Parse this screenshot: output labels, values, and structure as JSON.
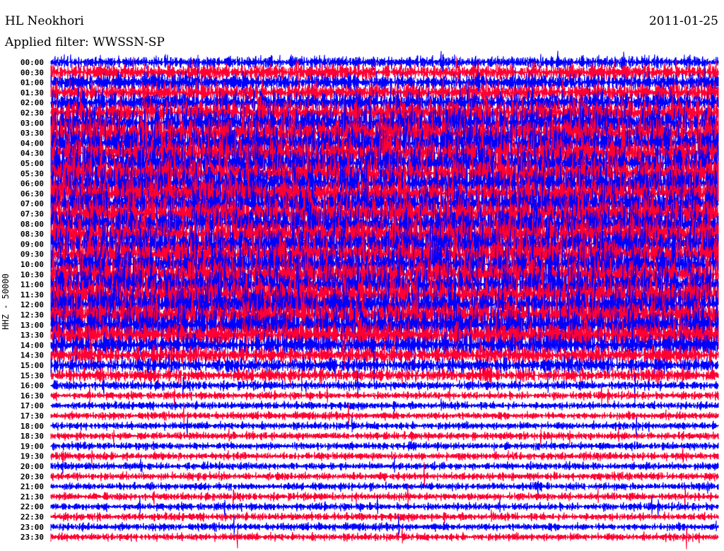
{
  "header": {
    "station": "HL Neokhori",
    "filter": "Applied filter: WWSSN-SP",
    "date": "2011-01-25"
  },
  "chart_data": {
    "type": "line",
    "title": "HL Neokhori",
    "subtitle": "Applied filter: WWSSN-SP",
    "date": "2011-01-25",
    "ylabel": "HHZ - 50000",
    "row_labels": [
      "00:00",
      "00:30",
      "01:00",
      "01:30",
      "02:00",
      "02:30",
      "03:00",
      "03:30",
      "04:00",
      "04:30",
      "05:00",
      "05:30",
      "06:00",
      "06:30",
      "07:00",
      "07:30",
      "08:00",
      "08:30",
      "09:00",
      "09:30",
      "10:00",
      "10:30",
      "11:00",
      "11:30",
      "12:00",
      "12:30",
      "13:00",
      "13:30",
      "14:00",
      "14:30",
      "15:00",
      "15:30",
      "16:00",
      "16:30",
      "17:00",
      "17:30",
      "18:00",
      "18:30",
      "19:00",
      "19:30",
      "20:00",
      "20:30",
      "21:00",
      "21:30",
      "22:00",
      "22:30",
      "23:00",
      "23:30"
    ],
    "row_colors": [
      "#0000ff",
      "#ff0033"
    ],
    "relative_amplitude": [
      0.3,
      0.45,
      0.5,
      0.55,
      0.6,
      0.8,
      0.9,
      1,
      1,
      1,
      1,
      1,
      1,
      1,
      1,
      1,
      1,
      1,
      1,
      1,
      1,
      1,
      1,
      1,
      1,
      0.95,
      0.9,
      0.8,
      0.6,
      0.5,
      0.4,
      0.35,
      0.2,
      0.15,
      0.15,
      0.15,
      0.15,
      0.15,
      0.15,
      0.15,
      0.15,
      0.15,
      0.15,
      0.15,
      0.15,
      0.15,
      0.15,
      0.15
    ],
    "minutes_per_row": 30
  }
}
